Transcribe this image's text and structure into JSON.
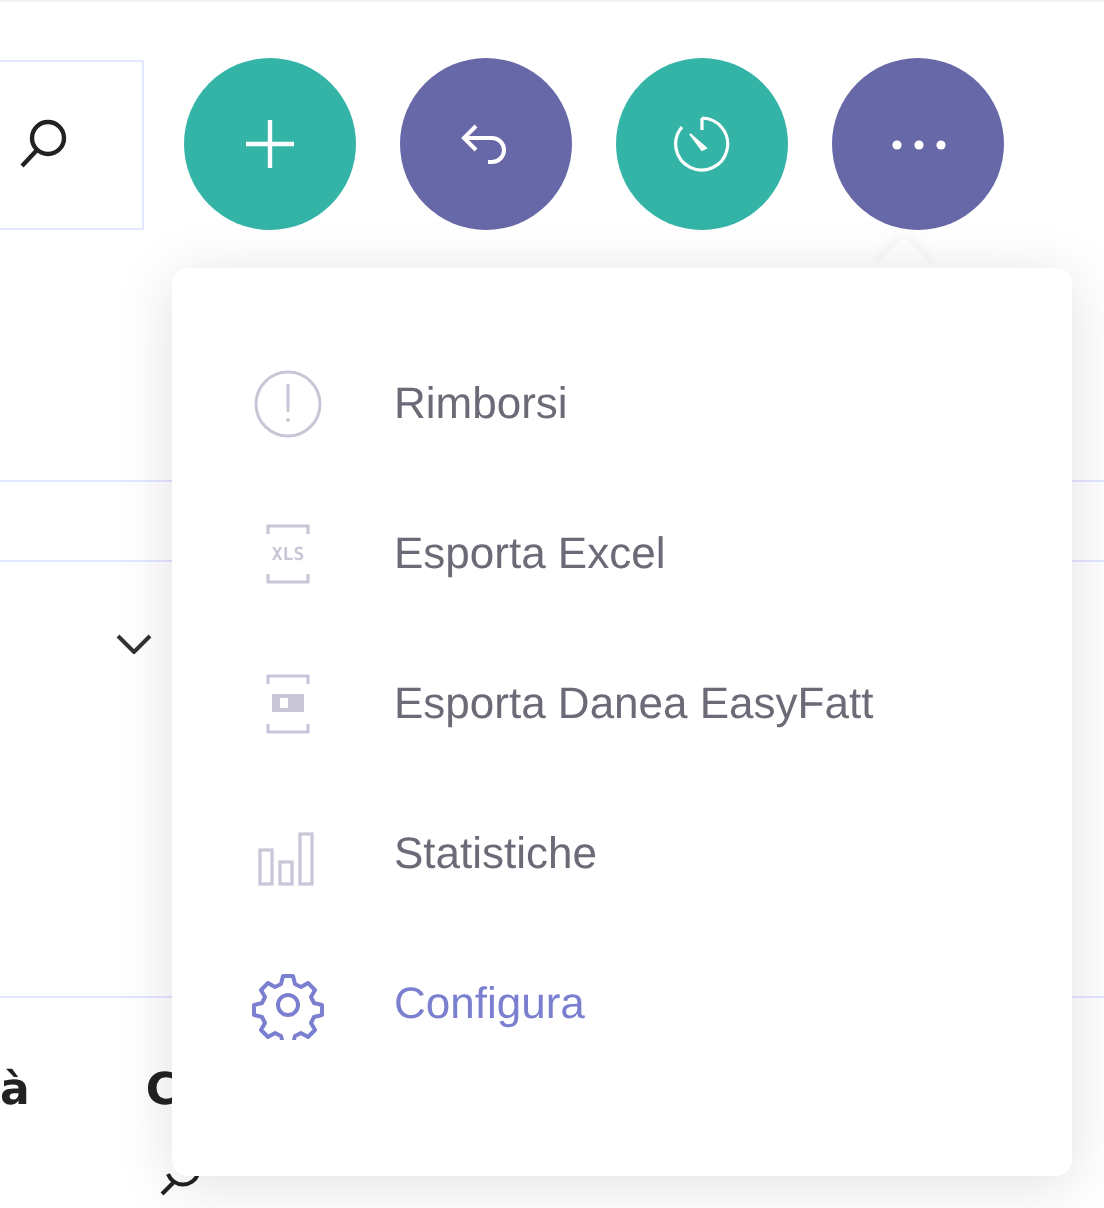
{
  "actions": [
    {
      "kind": "add",
      "color": "#34b4a6"
    },
    {
      "kind": "undo",
      "color": "#6768a8"
    },
    {
      "kind": "timer",
      "color": "#34b4a6"
    },
    {
      "kind": "more",
      "color": "#6768a8"
    }
  ],
  "table": {
    "columns": [
      {
        "label": "à"
      },
      {
        "label": "C"
      }
    ]
  },
  "menu": {
    "items": [
      {
        "kind": "alert",
        "label": "Rimborsi",
        "highlighted": false
      },
      {
        "kind": "xls",
        "icon_text": "XLS",
        "label": "Esporta Excel",
        "highlighted": false
      },
      {
        "kind": "xls-alt",
        "label": "Esporta Danea EasyFatt",
        "highlighted": false
      },
      {
        "kind": "chart",
        "label": "Statistiche",
        "highlighted": false
      },
      {
        "kind": "gear",
        "label": "Configura",
        "highlighted": true
      }
    ]
  }
}
